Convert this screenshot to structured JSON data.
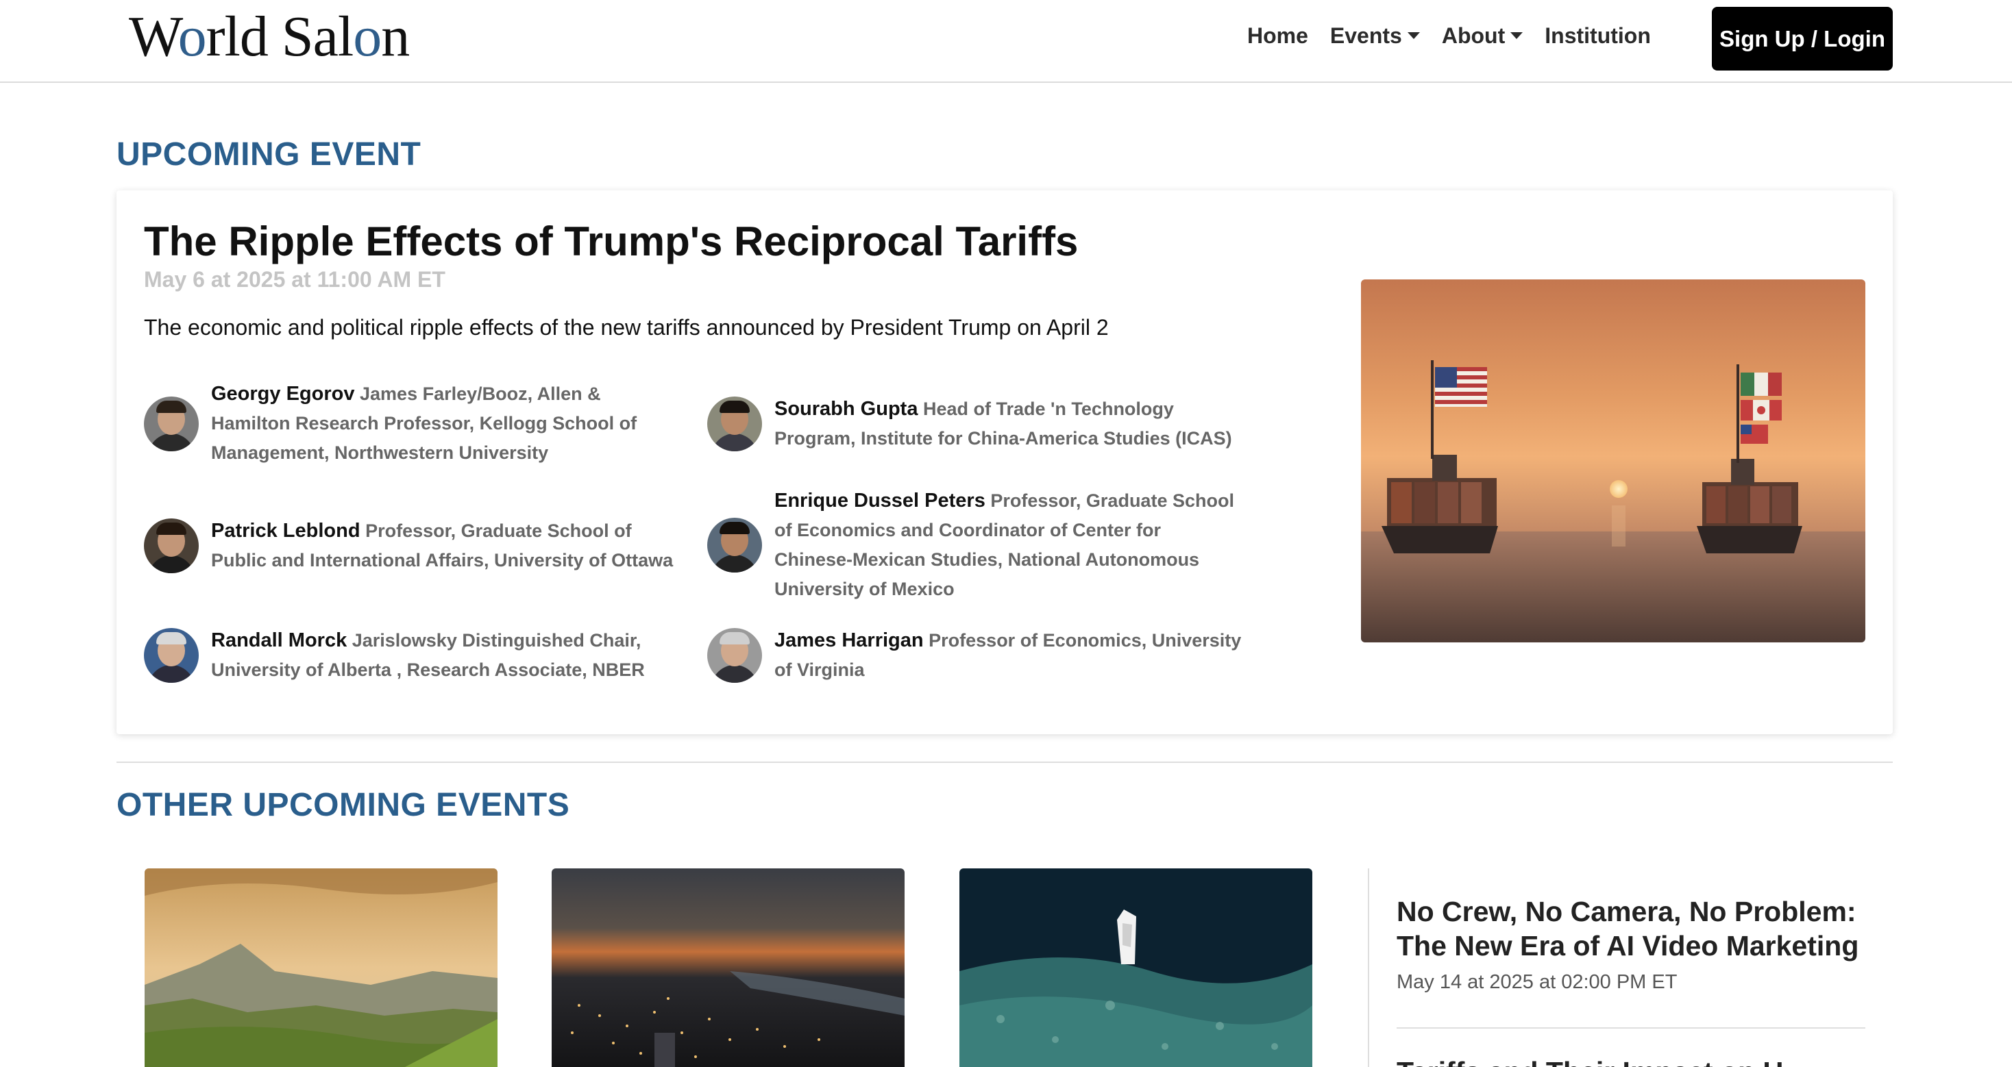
{
  "header": {
    "logo_text_1": "W",
    "logo_text_o": "o",
    "logo_text_2": "rld Sal",
    "logo_text_o2": "o",
    "logo_text_3": "n",
    "nav": {
      "home": "Home",
      "events": "Events",
      "about": "About",
      "institution": "Institution"
    },
    "signup_label": "Sign Up / Login"
  },
  "upcoming": {
    "heading": "UPCOMING EVENT",
    "title": "The Ripple Effects of Trump's Reciprocal Tariffs",
    "date": "May 6 at 2025 at 11:00 AM ET",
    "description": "The economic and political ripple effects of the new tariffs announced by President Trump on April 2",
    "speakers": [
      {
        "name": "Georgy Egorov",
        "affiliation": "James Farley/Booz, Allen & Hamilton Research Professor, Kellogg School of Management, Northwestern University"
      },
      {
        "name": "Sourabh Gupta",
        "affiliation": "Head of Trade 'n Technology Program, Institute for China-America Studies (ICAS)"
      },
      {
        "name": "Patrick Leblond",
        "affiliation": "Professor, Graduate School of Public and International Affairs, University of Ottawa"
      },
      {
        "name": "Enrique Dussel Peters",
        "affiliation": "Professor, Graduate School of Economics and Coordinator of Center for Chinese-Mexican Studies, National Autonomous University of Mexico"
      },
      {
        "name": "Randall Morck",
        "affiliation": "Jarislowsky Distinguished Chair, University of Alberta , Research Associate, NBER"
      },
      {
        "name": "James Harrigan",
        "affiliation": "Professor of Economics, University of Virginia"
      }
    ]
  },
  "other": {
    "heading": "OTHER UPCOMING EVENTS",
    "featured_side": {
      "title": "No Crew, No Camera, No Problem: The New Era of AI Video Marketing",
      "date": "May 14 at 2025 at 02:00 PM ET"
    },
    "next_side_title": "Tariffs and Their Impact on U"
  },
  "colors": {
    "accent": "#2a5e8c",
    "button_bg": "#000000"
  }
}
